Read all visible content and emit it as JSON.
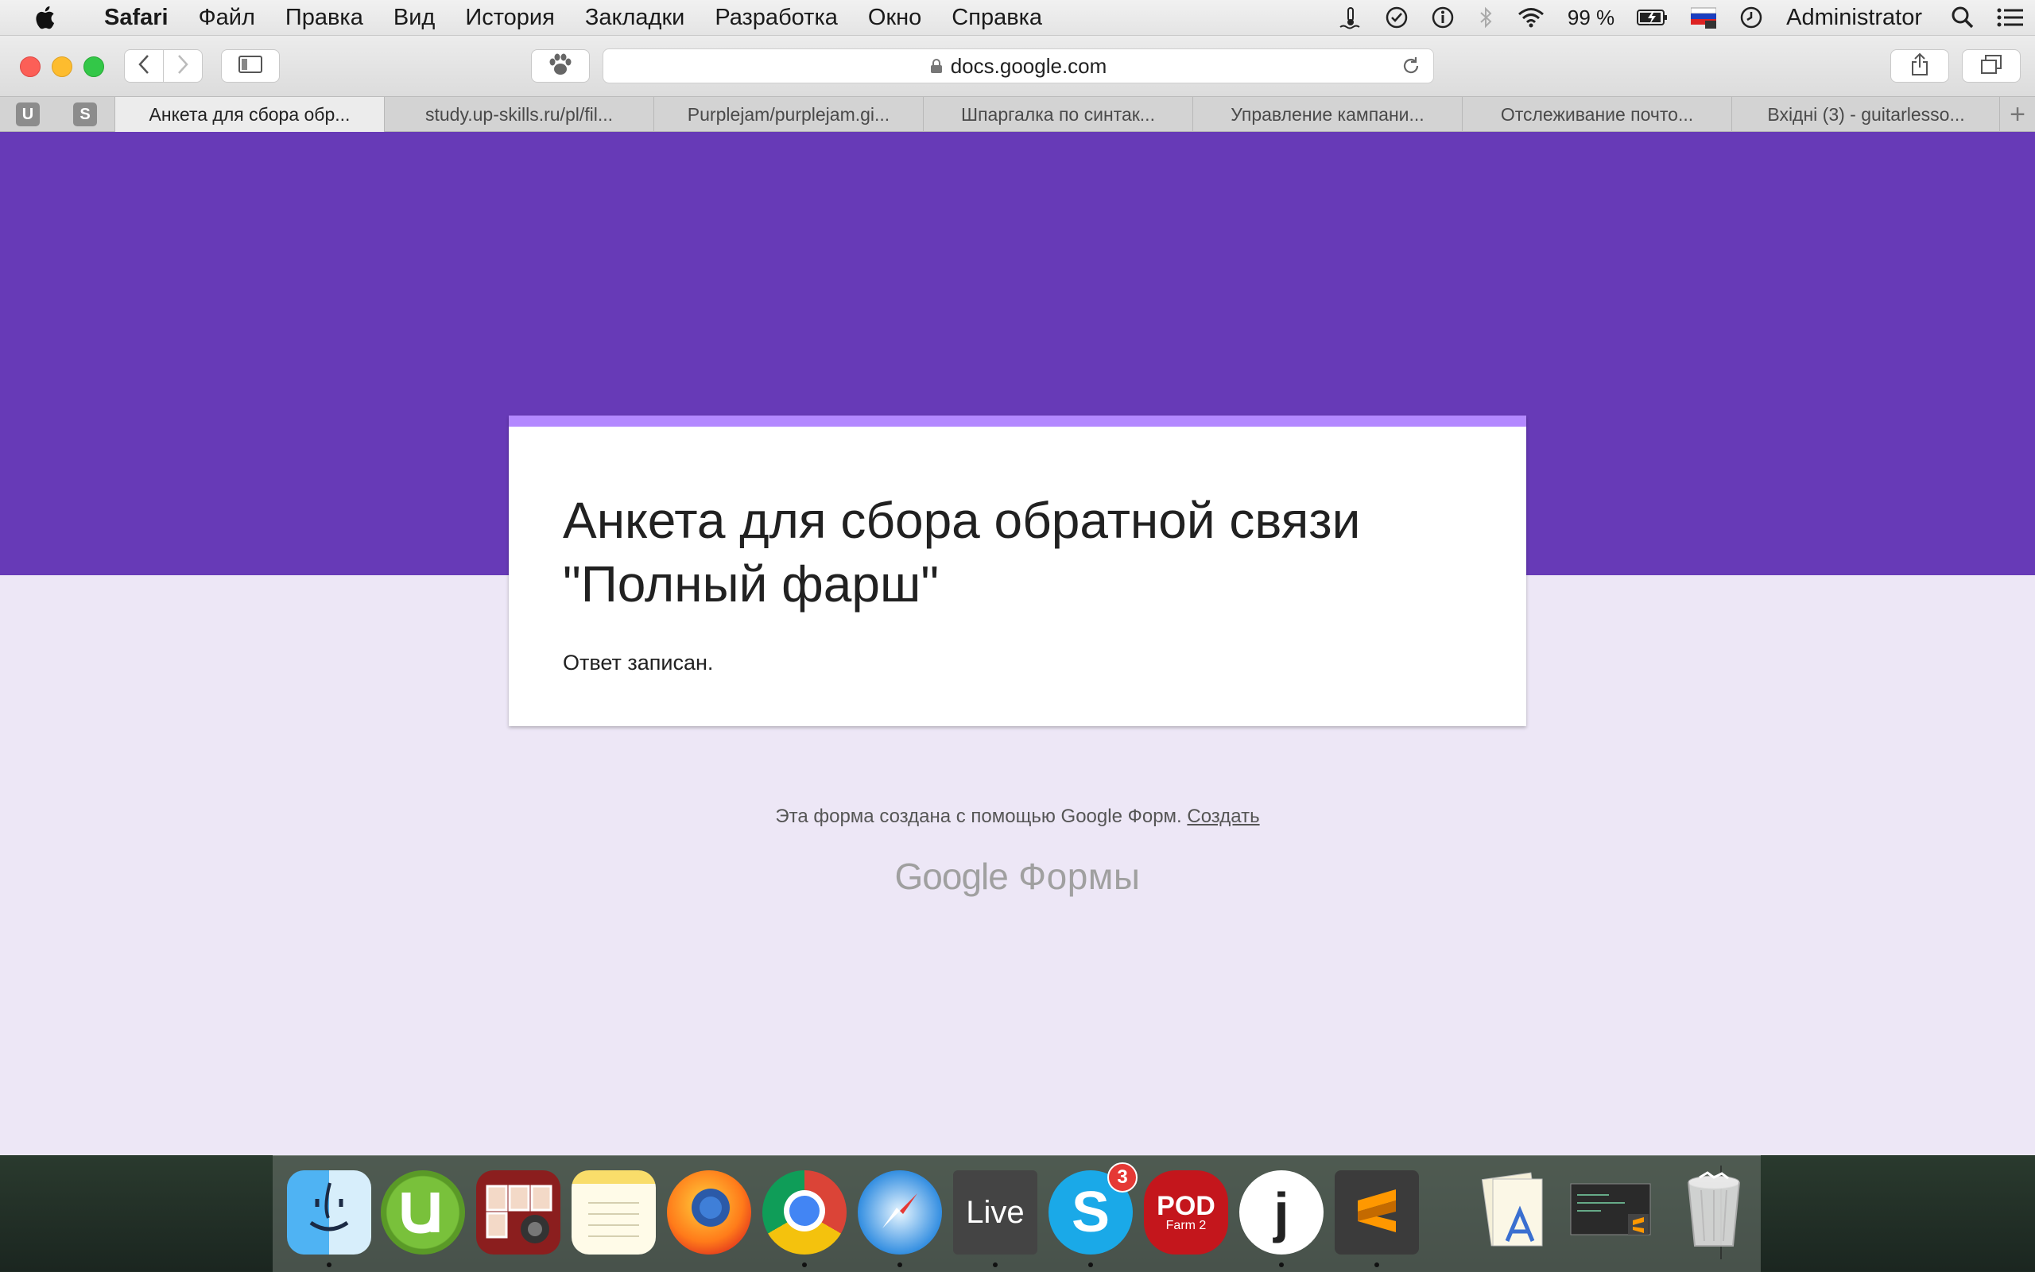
{
  "menubar": {
    "app_name": "Safari",
    "items": [
      "Файл",
      "Правка",
      "Вид",
      "История",
      "Закладки",
      "Разработка",
      "Окно",
      "Справка"
    ],
    "battery": "99 %",
    "user": "Administrator"
  },
  "browser": {
    "address": "docs.google.com",
    "pinned_tabs": [
      "U",
      "S"
    ],
    "tabs": [
      {
        "label": "Анкета для сбора обр..."
      },
      {
        "label": "study.up-skills.ru/pl/fil..."
      },
      {
        "label": "Purplejam/purplejam.gi..."
      },
      {
        "label": "Шпаргалка по синтак..."
      },
      {
        "label": "Управление кампани..."
      },
      {
        "label": "Отслеживание почто..."
      },
      {
        "label": "Вхідні (3) - guitarlesso..."
      }
    ],
    "new_tab": "+"
  },
  "form": {
    "title": "Анкета для сбора обратной связи \"Полный фарш\"",
    "message": "Ответ записан.",
    "footer_text": "Эта форма создана с помощью Google Форм.",
    "create_link": "Создать",
    "logo_google": "Google",
    "logo_forms": "Формы"
  },
  "dock": {
    "items": [
      "finder",
      "utorrent",
      "photo-booth",
      "notes",
      "firefox",
      "chrome",
      "safari",
      "ableton-live",
      "skype",
      "pod-farm-2",
      "joxi",
      "sublime-text",
      "applications-folder",
      "documents-stack",
      "trash"
    ],
    "live_label": "Live",
    "skype_badge": "3",
    "pod_label": "POD",
    "pod_sub": "Farm 2",
    "joxi_label": "j"
  },
  "colors": {
    "banner": "#673ab7",
    "page_bg": "#ede7f6",
    "card_accent": "#b388ff"
  }
}
